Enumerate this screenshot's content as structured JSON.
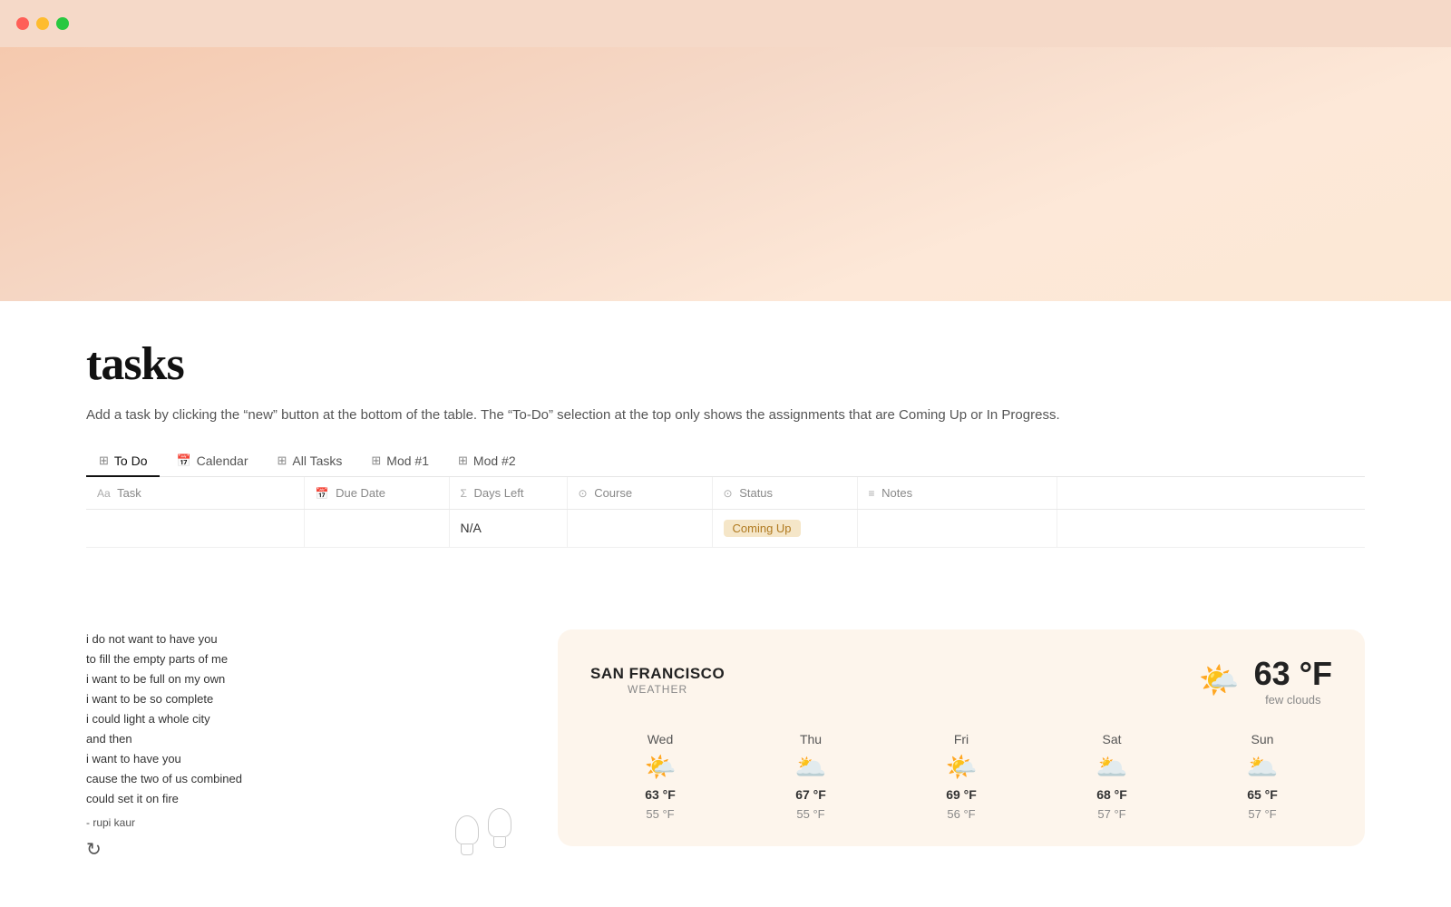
{
  "titlebar": {
    "traffic_lights": [
      "red",
      "yellow",
      "green"
    ]
  },
  "page": {
    "title": "tasks",
    "description": "Add a task by clicking the “new” button at the bottom of the table. The “To-Do” selection at the top only shows the assignments that are Coming Up or In Progress."
  },
  "tabs": [
    {
      "id": "todo",
      "label": "To Do",
      "icon": "⊞",
      "active": true
    },
    {
      "id": "calendar",
      "label": "Calendar",
      "icon": "📅",
      "active": false
    },
    {
      "id": "all-tasks",
      "label": "All Tasks",
      "icon": "⊞",
      "active": false
    },
    {
      "id": "mod1",
      "label": "Mod #1",
      "icon": "⊞",
      "active": false
    },
    {
      "id": "mod2",
      "label": "Mod #2",
      "icon": "⊞",
      "active": false
    }
  ],
  "table": {
    "columns": [
      {
        "id": "task",
        "icon": "Aa",
        "label": "Task"
      },
      {
        "id": "due",
        "icon": "📅",
        "label": "Due Date"
      },
      {
        "id": "days",
        "icon": "Σ",
        "label": "Days Left"
      },
      {
        "id": "course",
        "icon": "⊙",
        "label": "Course"
      },
      {
        "id": "status",
        "icon": "⊙",
        "label": "Status"
      },
      {
        "id": "notes",
        "icon": "≡",
        "label": "Notes"
      }
    ],
    "rows": [
      {
        "task": "",
        "due": "",
        "days": "N/A",
        "course": "",
        "status": "Coming Up",
        "notes": ""
      }
    ]
  },
  "quote": {
    "lines": [
      "i do not want to have you",
      "to fill the empty parts of me",
      "i want to be full on my own",
      "i want to be so complete",
      "i could light a whole city",
      "and then",
      "i want to have you",
      "cause the two of us combined",
      "could set it on fire"
    ],
    "author": "- rupi kaur"
  },
  "weather": {
    "city": "SAN FRANCISCO",
    "label": "WEATHER",
    "current": {
      "icon": "🌤️",
      "temp": "63 °F",
      "description": "few clouds"
    },
    "forecast": [
      {
        "day": "Wed",
        "icon": "🌤️",
        "hi": "63 °F",
        "lo": "55 °F"
      },
      {
        "day": "Thu",
        "icon": "🌥️",
        "hi": "67 °F",
        "lo": "55 °F"
      },
      {
        "day": "Fri",
        "icon": "🌤️",
        "hi": "69 °F",
        "lo": "56 °F"
      },
      {
        "day": "Sat",
        "icon": "🌥️",
        "hi": "68 °F",
        "lo": "57 °F"
      },
      {
        "day": "Sun",
        "icon": "🌥️",
        "hi": "65 °F",
        "lo": "57 °F"
      }
    ]
  },
  "refresh_label": "↻"
}
